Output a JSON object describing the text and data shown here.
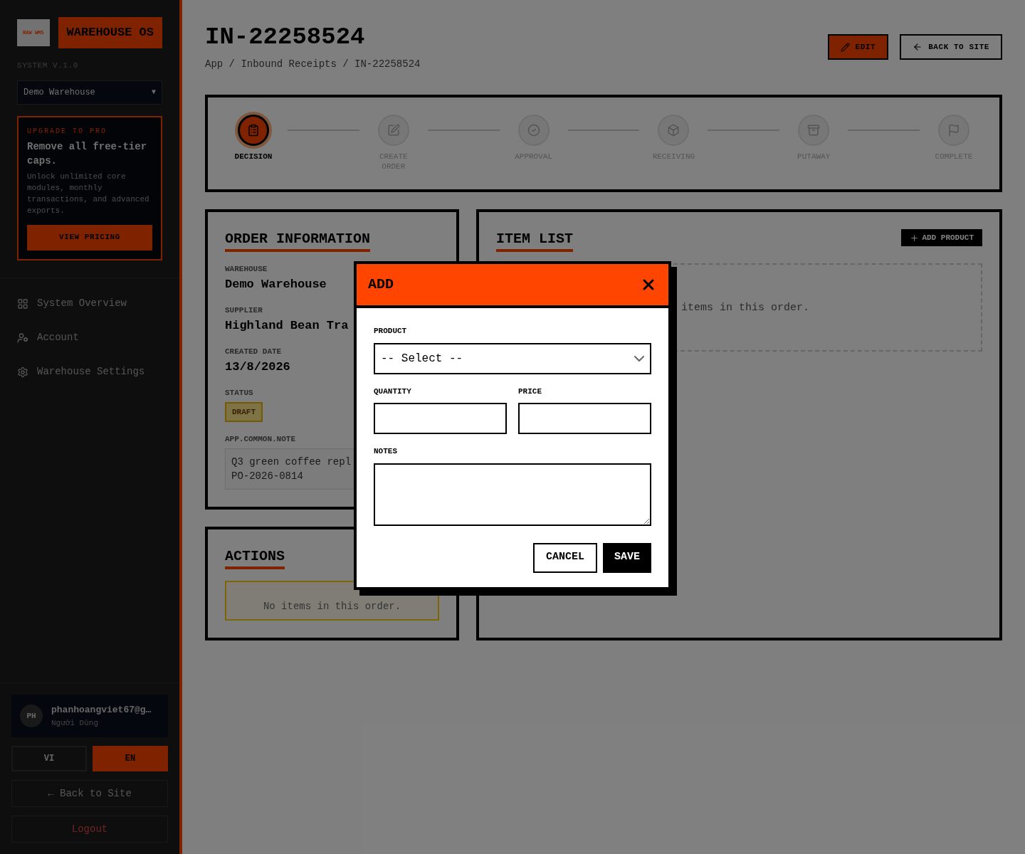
{
  "sidebar": {
    "logo_text": "RAW WMS",
    "brand": "WAREHOUSE OS",
    "version": "SYSTEM V.1.0",
    "warehouse_select": {
      "value": "Demo Warehouse",
      "arrow": "▼"
    },
    "promo": {
      "eyebrow": "UPGRADE TO PRO",
      "title": "Remove all free-tier caps.",
      "body": "Unlock unlimited core modules, monthly transactions, and advanced exports.",
      "button": "VIEW PRICING"
    },
    "nav": [
      {
        "label": "System Overview"
      },
      {
        "label": "Account"
      },
      {
        "label": "Warehouse Settings"
      }
    ],
    "user": {
      "initials": "PH",
      "email": "phanhoangviet67@g…",
      "role": "Người Dùng"
    },
    "languages": [
      {
        "label": "VI",
        "selected": false
      },
      {
        "label": "EN",
        "selected": true
      }
    ],
    "back_link": "← Back to Site",
    "logout": "Logout"
  },
  "header": {
    "title": "IN-22258524",
    "breadcrumb": "App / Inbound Receipts / IN-22258524",
    "edit_button": "EDIT",
    "back_button": "BACK TO SITE"
  },
  "steps": [
    {
      "label": "DECISION",
      "selected": true
    },
    {
      "label": "CREATE ORDER",
      "selected": false
    },
    {
      "label": "APPROVAL",
      "selected": false
    },
    {
      "label": "RECEIVING",
      "selected": false
    },
    {
      "label": "PUTAWAY",
      "selected": false
    },
    {
      "label": "COMPLETE",
      "selected": false
    }
  ],
  "order_info": {
    "title": "ORDER INFORMATION",
    "fields": [
      {
        "label": "WAREHOUSE",
        "value": "Demo Warehouse"
      },
      {
        "label": "SUPPLIER",
        "value": "Highland Bean Tra"
      },
      {
        "label": "CREATED DATE",
        "value": "13/8/2026"
      }
    ],
    "status_label": "STATUS",
    "status": "DRAFT",
    "note_label": "APP.COMMON.NOTE",
    "note_lines": [
      "Q3 green coffee repl",
      "PO-2026-0814"
    ]
  },
  "actions": {
    "title": "ACTIONS",
    "empty": "No items in this order."
  },
  "item_list": {
    "title": "ITEM LIST",
    "add_button": "ADD PRODUCT",
    "empty": "items in this order."
  },
  "modal": {
    "title": "ADD",
    "product_label": "PRODUCT",
    "product_placeholder": "-- Select --",
    "quantity_label": "QUANTITY",
    "price_label": "PRICE",
    "notes_label": "NOTES",
    "cancel": "CANCEL",
    "save": "SAVE"
  }
}
